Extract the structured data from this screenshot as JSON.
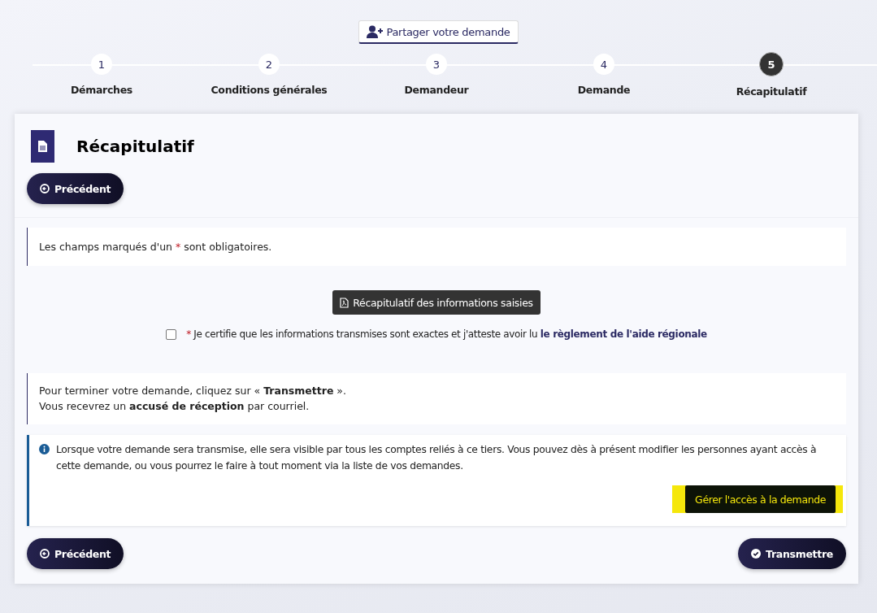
{
  "share_button": "Partager votre demande",
  "steps": [
    {
      "number": "1",
      "label": "Démarches",
      "selected": false
    },
    {
      "number": "2",
      "label": "Conditions générales",
      "selected": false
    },
    {
      "number": "3",
      "label": "Demandeur",
      "selected": false
    },
    {
      "number": "4",
      "label": "Demande",
      "selected": false
    },
    {
      "number": "5",
      "label": "Récapitulatif",
      "selected": true
    }
  ],
  "panel": {
    "title": "Récapitulatif",
    "back_button_top": "Précédent",
    "required_notice": {
      "before": "Les champs marqués d'un",
      "mark": "*",
      "after": "sont obligatoires."
    },
    "summary_button": "Récapitulatif des informations saisies",
    "certify": {
      "checked": false,
      "mark": "*",
      "text": "Je certifie que les informations transmises sont exactes et j'atteste avoir lu",
      "link": "le règlement de l'aide régionale"
    },
    "finish_lines": [
      "Pour terminer votre demande, cliquez sur « **Transmettre** ».",
      "Vous recevrez un **accusé de réception** par courriel."
    ],
    "info_text": "Lorsque votre demande sera transmise, elle sera visible par tous les comptes reliés à ce tiers. Vous pouvez dès à présent modifier les personnes ayant accès à cette demande, ou vous pourrez le faire à tout moment via la liste de vos demandes.",
    "manage_button": "Gérer l'accès à la demande",
    "back_button_bottom": "Précédent",
    "submit_button": "Transmettre"
  }
}
